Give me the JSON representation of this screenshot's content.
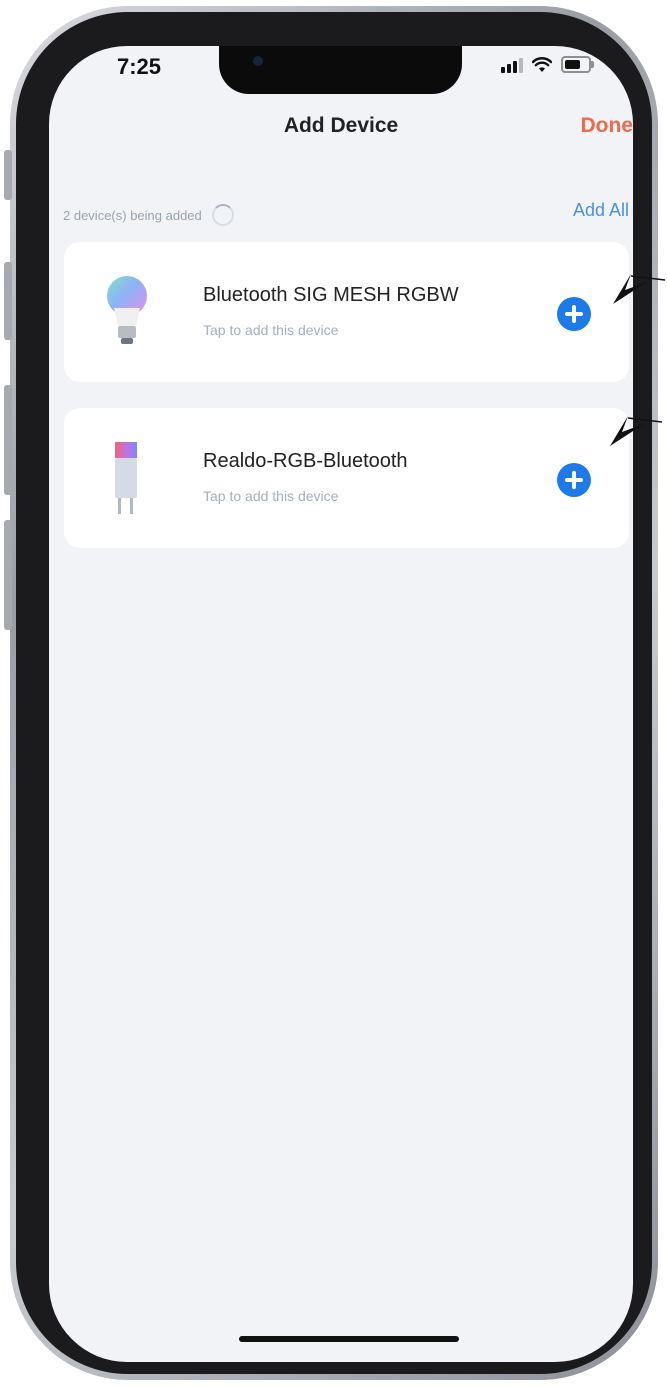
{
  "status_bar": {
    "time": "7:25"
  },
  "nav": {
    "title": "Add Device",
    "done_label": "Done",
    "done_color": "#ef6a4c"
  },
  "summary": {
    "text": "2 device(s) being added",
    "add_all_label": "Add All"
  },
  "devices": [
    {
      "name": "Bluetooth SIG MESH RGBW",
      "subtitle": "Tap to add this device",
      "icon": "rgb-bulb-icon"
    },
    {
      "name": "Realdo-RGB-Bluetooth",
      "subtitle": "Tap to add this device",
      "icon": "rgb-light-strip-controller-icon"
    }
  ],
  "colors": {
    "accent_blue": "#1d7ae8",
    "link_blue": "#4a90e2",
    "background": "#f1f3f7"
  }
}
